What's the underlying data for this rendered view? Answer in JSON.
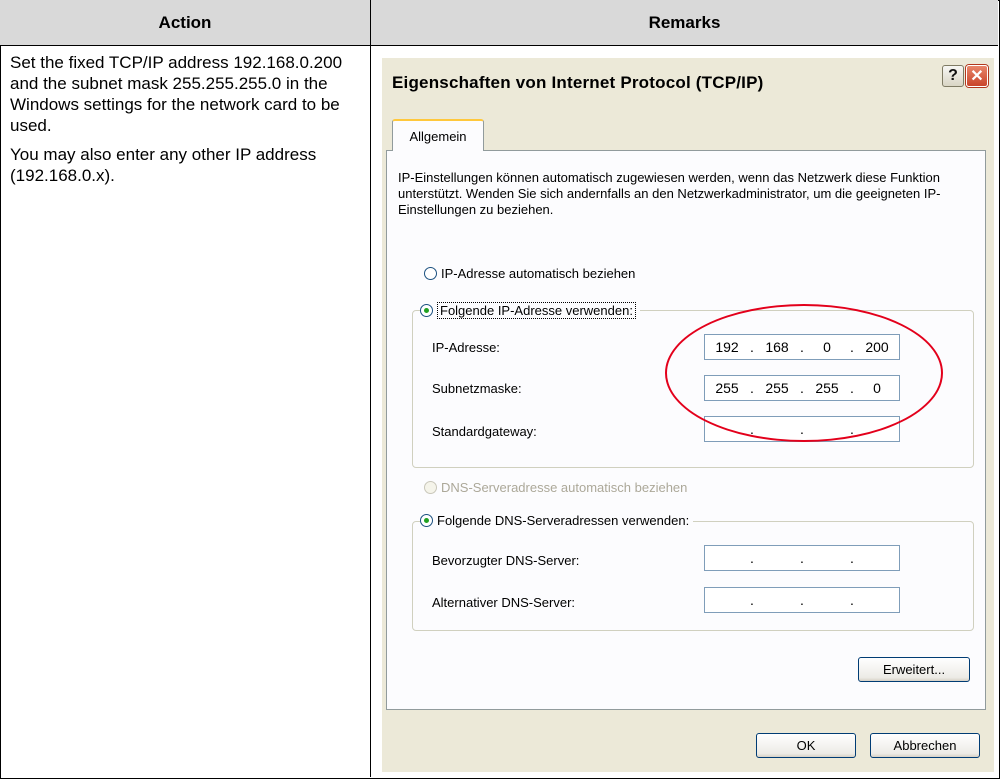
{
  "table": {
    "header_action": "Action",
    "header_remarks": "Remarks",
    "action_paragraph_1": "Set the fixed TCP/IP address 192.168.0.200 and the subnet mask 255.255.255.0 in the Windows settings for the network card to be used.",
    "action_paragraph_2": "You may also enter any other IP address (192.168.0.x)."
  },
  "dialog": {
    "title": "Eigenschaften von Internet Protocol (TCP/IP)",
    "help_glyph": "?",
    "close_glyph": "✕",
    "tab_label": "Allgemein",
    "intro_text": "IP-Einstellungen können automatisch zugewiesen werden, wenn das Netzwerk diese Funktion unterstützt. Wenden Sie sich andernfalls an den Netzwerkadministrator, um die geeigneten IP-Einstellungen zu beziehen.",
    "ip_auto": {
      "label": "IP-Adresse automatisch beziehen",
      "checked": false
    },
    "ip_manual": {
      "label": "Folgende IP-Adresse verwenden:",
      "checked": true
    },
    "ip_fields": {
      "ip_label": "IP-Adresse:",
      "ip_value": [
        "192",
        "168",
        "0",
        "200"
      ],
      "subnet_label": "Subnetzmaske:",
      "subnet_value": [
        "255",
        "255",
        "255",
        "0"
      ],
      "gateway_label": "Standardgateway:",
      "gateway_value": [
        "",
        "",
        "",
        ""
      ]
    },
    "dns_auto": {
      "label": "DNS-Serveradresse automatisch beziehen",
      "checked": false,
      "disabled": true
    },
    "dns_manual": {
      "label": "Folgende DNS-Serveradressen verwenden:",
      "checked": true
    },
    "dns_fields": {
      "preferred_label": "Bevorzugter DNS-Server:",
      "preferred_value": [
        "",
        "",
        "",
        ""
      ],
      "alternate_label": "Alternativer DNS-Server:",
      "alternate_value": [
        "",
        "",
        "",
        ""
      ]
    },
    "advanced_button": "Erweitert...",
    "ok_button": "OK",
    "cancel_button": "Abbrechen",
    "annotation_color": "#e3001b"
  }
}
